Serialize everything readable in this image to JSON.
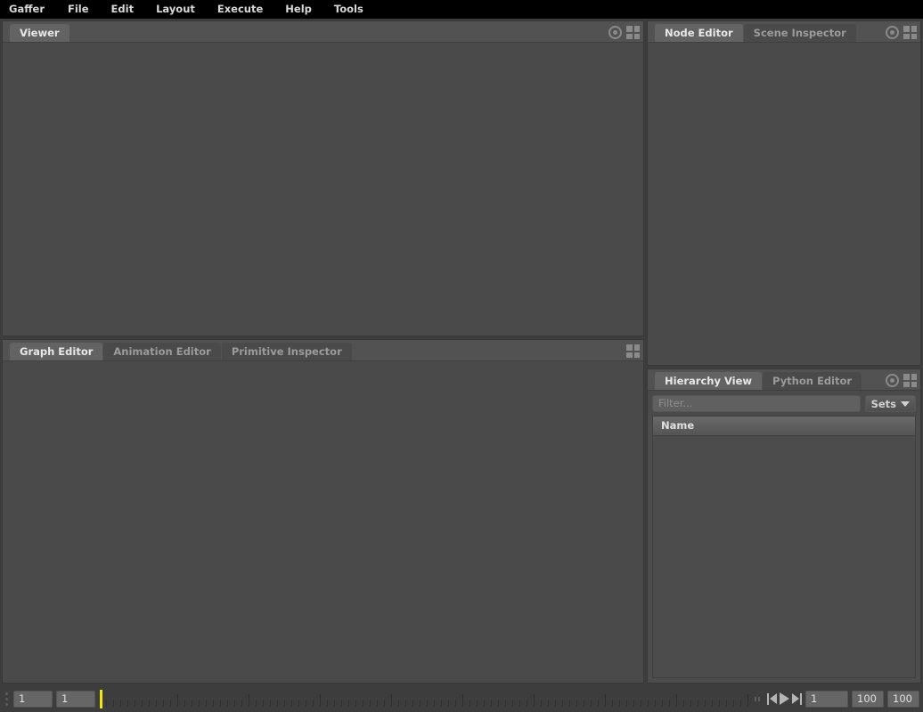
{
  "app": {
    "title": "Gaffer"
  },
  "menubar": {
    "items": [
      {
        "label": "Gaffer"
      },
      {
        "label": "File"
      },
      {
        "label": "Edit"
      },
      {
        "label": "Layout"
      },
      {
        "label": "Execute"
      },
      {
        "label": "Help"
      },
      {
        "label": "Tools"
      }
    ]
  },
  "panels": {
    "viewer": {
      "tabs": [
        {
          "label": "Viewer",
          "active": true
        }
      ],
      "icons": [
        "target-icon",
        "layout-grid-icon"
      ]
    },
    "graph_editor": {
      "tabs": [
        {
          "label": "Graph Editor",
          "active": true
        },
        {
          "label": "Animation Editor",
          "active": false
        },
        {
          "label": "Primitive Inspector",
          "active": false
        }
      ],
      "icons": [
        "layout-grid-icon"
      ]
    },
    "node_editor": {
      "tabs": [
        {
          "label": "Node Editor",
          "active": true
        },
        {
          "label": "Scene Inspector",
          "active": false
        }
      ],
      "icons": [
        "target-icon",
        "layout-grid-icon"
      ]
    },
    "hierarchy_view": {
      "tabs": [
        {
          "label": "Hierarchy View",
          "active": true
        },
        {
          "label": "Python Editor",
          "active": false
        }
      ],
      "icons": [
        "target-icon",
        "layout-grid-icon"
      ],
      "filter": {
        "placeholder": "Filter...",
        "value": ""
      },
      "sets_button": {
        "label": "Sets"
      },
      "table": {
        "columns": [
          "Name"
        ],
        "rows": []
      }
    }
  },
  "timeline": {
    "frame_start_field": "1",
    "playback_field": "1",
    "current_frame_field": "1",
    "range_end_field": "100",
    "fps_field": "100",
    "transport": [
      "skip-to-start-icon",
      "play-icon",
      "skip-to-end-icon"
    ],
    "playhead_frame": "1"
  },
  "colors": {
    "background": "#3d3d3d",
    "panel": "#4a4a4a",
    "menubar": "#000000",
    "tab_active": "#636363",
    "tab_inactive": "#4a4a4a",
    "text": "#c8c8c8",
    "playhead": "#f2e70d"
  }
}
